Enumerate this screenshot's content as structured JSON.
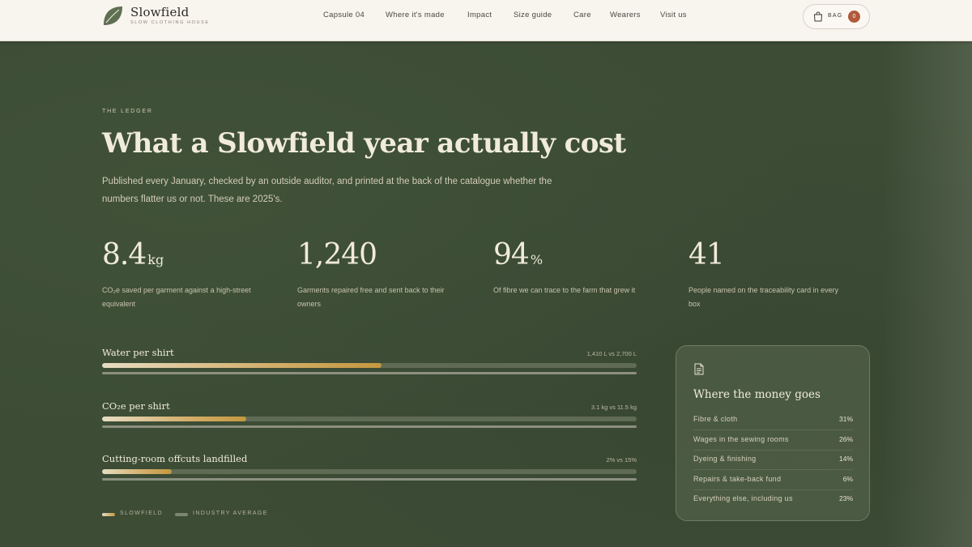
{
  "brand": {
    "name": "Slowfield",
    "tagline": "Slow clothing house"
  },
  "nav": {
    "items": [
      {
        "label": "Capsule 04"
      },
      {
        "label": "Where it's made"
      },
      {
        "label": "Impact"
      },
      {
        "label": "Size guide"
      },
      {
        "label": "Care"
      },
      {
        "label": "Wearers"
      },
      {
        "label": "Visit us"
      }
    ]
  },
  "bag": {
    "label": "BAG",
    "count": "0"
  },
  "hero": {
    "eyebrow": "THE LEDGER",
    "title": "What a Slowfield year actually cost",
    "lede": "Published every January, checked by an outside auditor, and printed at the back of the catalogue whether the numbers flatter us or not. These are 2025's."
  },
  "stats": [
    {
      "value": "8.4",
      "unit": "kg",
      "description": "CO₂e saved per garment against a high-street equivalent"
    },
    {
      "value": "1,240",
      "unit": "",
      "description": "Garments repaired free and sent back to their owners"
    },
    {
      "value": "94",
      "unit": "%",
      "description": "Of fibre we can trace to the farm that grew it"
    },
    {
      "value": "41",
      "unit": "",
      "description": "People named on the traceability card in every box"
    }
  ],
  "comparisons": [
    {
      "label": "Water per shirt",
      "compare": "1,410 L vs 2,700 L",
      "slowfield": 1410,
      "industry": 2700,
      "fill": 0.522
    },
    {
      "label": "CO₂e per shirt",
      "compare": "3.1 kg vs 11.5 kg",
      "slowfield": 3.1,
      "industry": 11.5,
      "fill": 0.27
    },
    {
      "label": "Cutting-room offcuts landfilled",
      "compare": "2% vs 15%",
      "slowfield": 2,
      "industry": 15,
      "fill": 0.13
    }
  ],
  "legend": {
    "slowfield": "SLOWFIELD",
    "industry": "INDUSTRY AVERAGE"
  },
  "money": {
    "title": "Where the money goes",
    "rows": [
      {
        "label": "Fibre & cloth",
        "pct": "31%"
      },
      {
        "label": "Wages in the sewing rooms",
        "pct": "26%"
      },
      {
        "label": "Dyeing & finishing",
        "pct": "14%"
      },
      {
        "label": "Repairs & take-back fund",
        "pct": "6%"
      },
      {
        "label": "Everything else, including us",
        "pct": "23%"
      }
    ]
  },
  "colors": {
    "background": "#3c4c35",
    "header": "#f8f4ee",
    "accent": "#c4983f",
    "badge": "#b05a3a"
  }
}
